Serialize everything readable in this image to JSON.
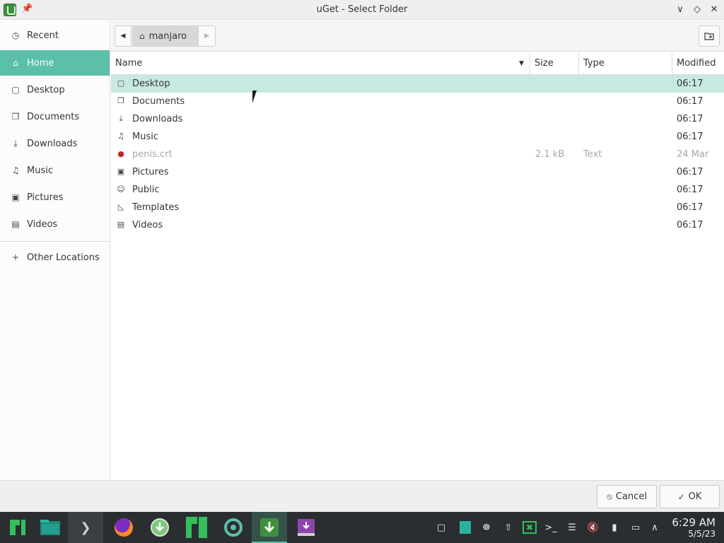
{
  "window": {
    "title": "uGet - Select Folder"
  },
  "sidebar": {
    "items": [
      {
        "label": "Recent",
        "icon": "clock-icon"
      },
      {
        "label": "Home",
        "icon": "home-icon"
      },
      {
        "label": "Desktop",
        "icon": "desktop-icon"
      },
      {
        "label": "Documents",
        "icon": "documents-icon"
      },
      {
        "label": "Downloads",
        "icon": "downloads-icon"
      },
      {
        "label": "Music",
        "icon": "music-icon"
      },
      {
        "label": "Pictures",
        "icon": "pictures-icon"
      },
      {
        "label": "Videos",
        "icon": "videos-icon"
      }
    ],
    "other_locations": "Other Locations",
    "active": "Home"
  },
  "pathbar": {
    "crumb": "manjaro"
  },
  "columns": {
    "name": "Name",
    "size": "Size",
    "type": "Type",
    "modified": "Modified"
  },
  "files": [
    {
      "name": "Desktop",
      "size": "",
      "type": "",
      "modified": "06:17",
      "icon": "desktop-icon",
      "selected": true
    },
    {
      "name": "Documents",
      "size": "",
      "type": "",
      "modified": "06:17",
      "icon": "documents-icon"
    },
    {
      "name": "Downloads",
      "size": "",
      "type": "",
      "modified": "06:17",
      "icon": "downloads-icon"
    },
    {
      "name": "Music",
      "size": "",
      "type": "",
      "modified": "06:17",
      "icon": "music-icon"
    },
    {
      "name": "penis.crt",
      "size": "2.1 kB",
      "type": "Text",
      "modified": "24 Mar",
      "icon": "certificate-icon",
      "dimmed": true
    },
    {
      "name": "Pictures",
      "size": "",
      "type": "",
      "modified": "06:17",
      "icon": "pictures-icon"
    },
    {
      "name": "Public",
      "size": "",
      "type": "",
      "modified": "06:17",
      "icon": "public-icon"
    },
    {
      "name": "Templates",
      "size": "",
      "type": "",
      "modified": "06:17",
      "icon": "templates-icon"
    },
    {
      "name": "Videos",
      "size": "",
      "type": "",
      "modified": "06:17",
      "icon": "videos-icon"
    }
  ],
  "actions": {
    "cancel": "Cancel",
    "ok": "OK"
  },
  "taskbar": {
    "time": "6:29 AM",
    "date": "5/5/23",
    "accent": "#5cbfa8"
  }
}
